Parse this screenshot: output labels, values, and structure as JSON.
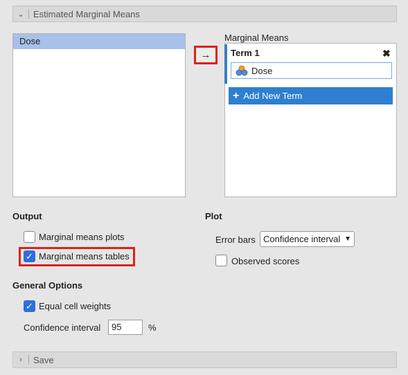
{
  "header": {
    "title": "Estimated Marginal Means"
  },
  "variables": [
    {
      "label": "Dose"
    }
  ],
  "marginal_means": {
    "label": "Marginal Means",
    "term_title": "Term 1",
    "term_items": [
      {
        "label": "Dose"
      }
    ],
    "add_term_label": "Add New Term"
  },
  "arrow_label": "→",
  "output": {
    "heading": "Output",
    "plots_label": "Marginal means plots",
    "plots_checked": false,
    "tables_label": "Marginal means tables",
    "tables_checked": true
  },
  "plot": {
    "heading": "Plot",
    "error_bars_label": "Error bars",
    "error_bars_value": "Confidence interval",
    "observed_label": "Observed scores",
    "observed_checked": false
  },
  "general": {
    "heading": "General Options",
    "equal_weights_label": "Equal cell weights",
    "equal_weights_checked": true,
    "ci_label": "Confidence interval",
    "ci_value": "95",
    "ci_unit": "%"
  },
  "save": {
    "title": "Save"
  },
  "icons": {
    "expanded": "chevron-down-icon",
    "collapsed": "chevron-right-icon",
    "close": "close-icon",
    "variable": "nominal-variable-icon",
    "plus": "plus-icon",
    "check": "check-icon"
  },
  "colors": {
    "accent": "#2f7fd0",
    "highlight": "#e0201a",
    "selection": "#a8c0ea"
  }
}
